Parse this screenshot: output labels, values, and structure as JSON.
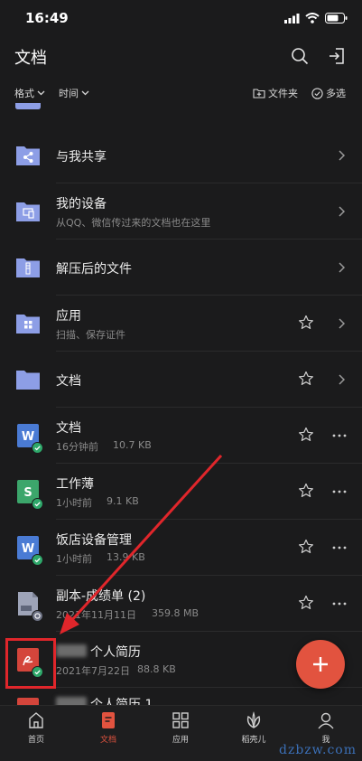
{
  "status": {
    "time": "16:49"
  },
  "header": {
    "title": "文档"
  },
  "filters": {
    "format": "格式",
    "time": "时间",
    "new_folder": "文件夹",
    "multi_select": "多选"
  },
  "rows": [
    {
      "title": "与我共享",
      "subtitle": ""
    },
    {
      "title": "我的设备",
      "subtitle": "从QQ、微信传过来的文档也在这里"
    },
    {
      "title": "解压后的文件",
      "subtitle": ""
    },
    {
      "title": "应用",
      "subtitle": "扫描、保存证件"
    },
    {
      "title": "文档",
      "subtitle": ""
    },
    {
      "title": "文档",
      "time": "16分钟前",
      "size": "10.7 KB"
    },
    {
      "title": "工作薄",
      "time": "1小时前",
      "size": "9.1 KB"
    },
    {
      "title": "饭店设备管理",
      "time": "1小时前",
      "size": "13.9 KB"
    },
    {
      "title": "副本-成绩单 (2)",
      "time": "2021年11月11日",
      "size": "359.8 MB"
    },
    {
      "title": "个人简历",
      "time": "2021年7月22日",
      "size": "88.8 KB"
    },
    {
      "title": "个人简历 1",
      "time": "",
      "size": ""
    }
  ],
  "tabs": [
    {
      "label": "首页"
    },
    {
      "label": "文档"
    },
    {
      "label": "应用"
    },
    {
      "label": "稻壳儿"
    },
    {
      "label": "我"
    }
  ],
  "watermark": "dzbzw.com",
  "colors": {
    "accent": "#e2533f",
    "folder": "#8d9ee6",
    "word": "#4a7bd4",
    "sheet": "#3ca66b",
    "pdf": "#d4453b"
  }
}
